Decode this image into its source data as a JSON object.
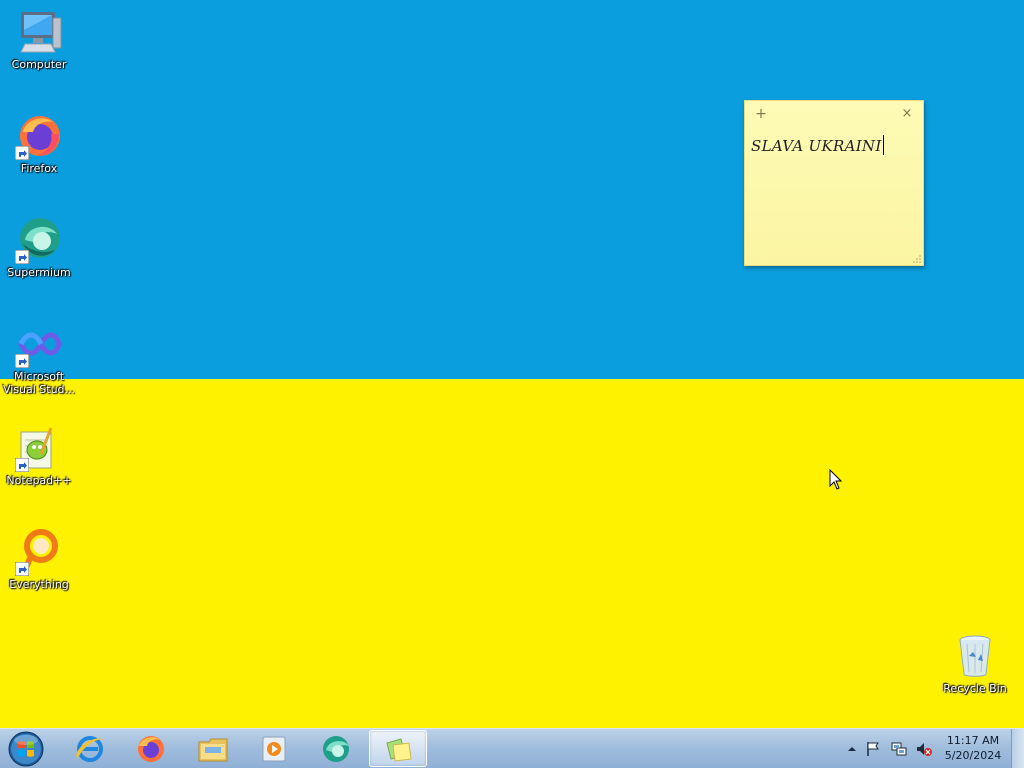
{
  "desktop": {
    "background_colors": {
      "top": "#0a9ede",
      "bottom": "#fff200"
    },
    "icons": [
      {
        "label": "Computer",
        "icon": "computer-icon"
      },
      {
        "label": "Firefox",
        "icon": "firefox-icon"
      },
      {
        "label": "Supermium",
        "icon": "supermium-icon"
      },
      {
        "label": "Microsoft\nVisual Stud...",
        "icon": "visual-studio-icon"
      },
      {
        "label": "Notepad++",
        "icon": "notepad-plus-plus-icon"
      },
      {
        "label": "Everything",
        "icon": "everything-icon"
      },
      {
        "label": "Recycle Bin",
        "icon": "recycle-bin-icon"
      }
    ]
  },
  "sticky_note": {
    "add_glyph": "+",
    "close_glyph": "×",
    "text": "SLAVA UKRAINI",
    "color": "#fdfbb6"
  },
  "taskbar": {
    "buttons": [
      {
        "icon": "start-orb-icon"
      },
      {
        "icon": "internet-explorer-icon"
      },
      {
        "icon": "firefox-icon"
      },
      {
        "icon": "file-explorer-icon"
      },
      {
        "icon": "media-player-icon"
      },
      {
        "icon": "supermium-icon"
      },
      {
        "icon": "sticky-notes-icon",
        "active": true
      }
    ],
    "tray": {
      "icons": [
        "show-hidden-icons-icon",
        "action-center-flag-icon",
        "network-icon",
        "volume-muted-icon"
      ],
      "time": "11:17 AM",
      "date": "5/20/2024"
    }
  }
}
